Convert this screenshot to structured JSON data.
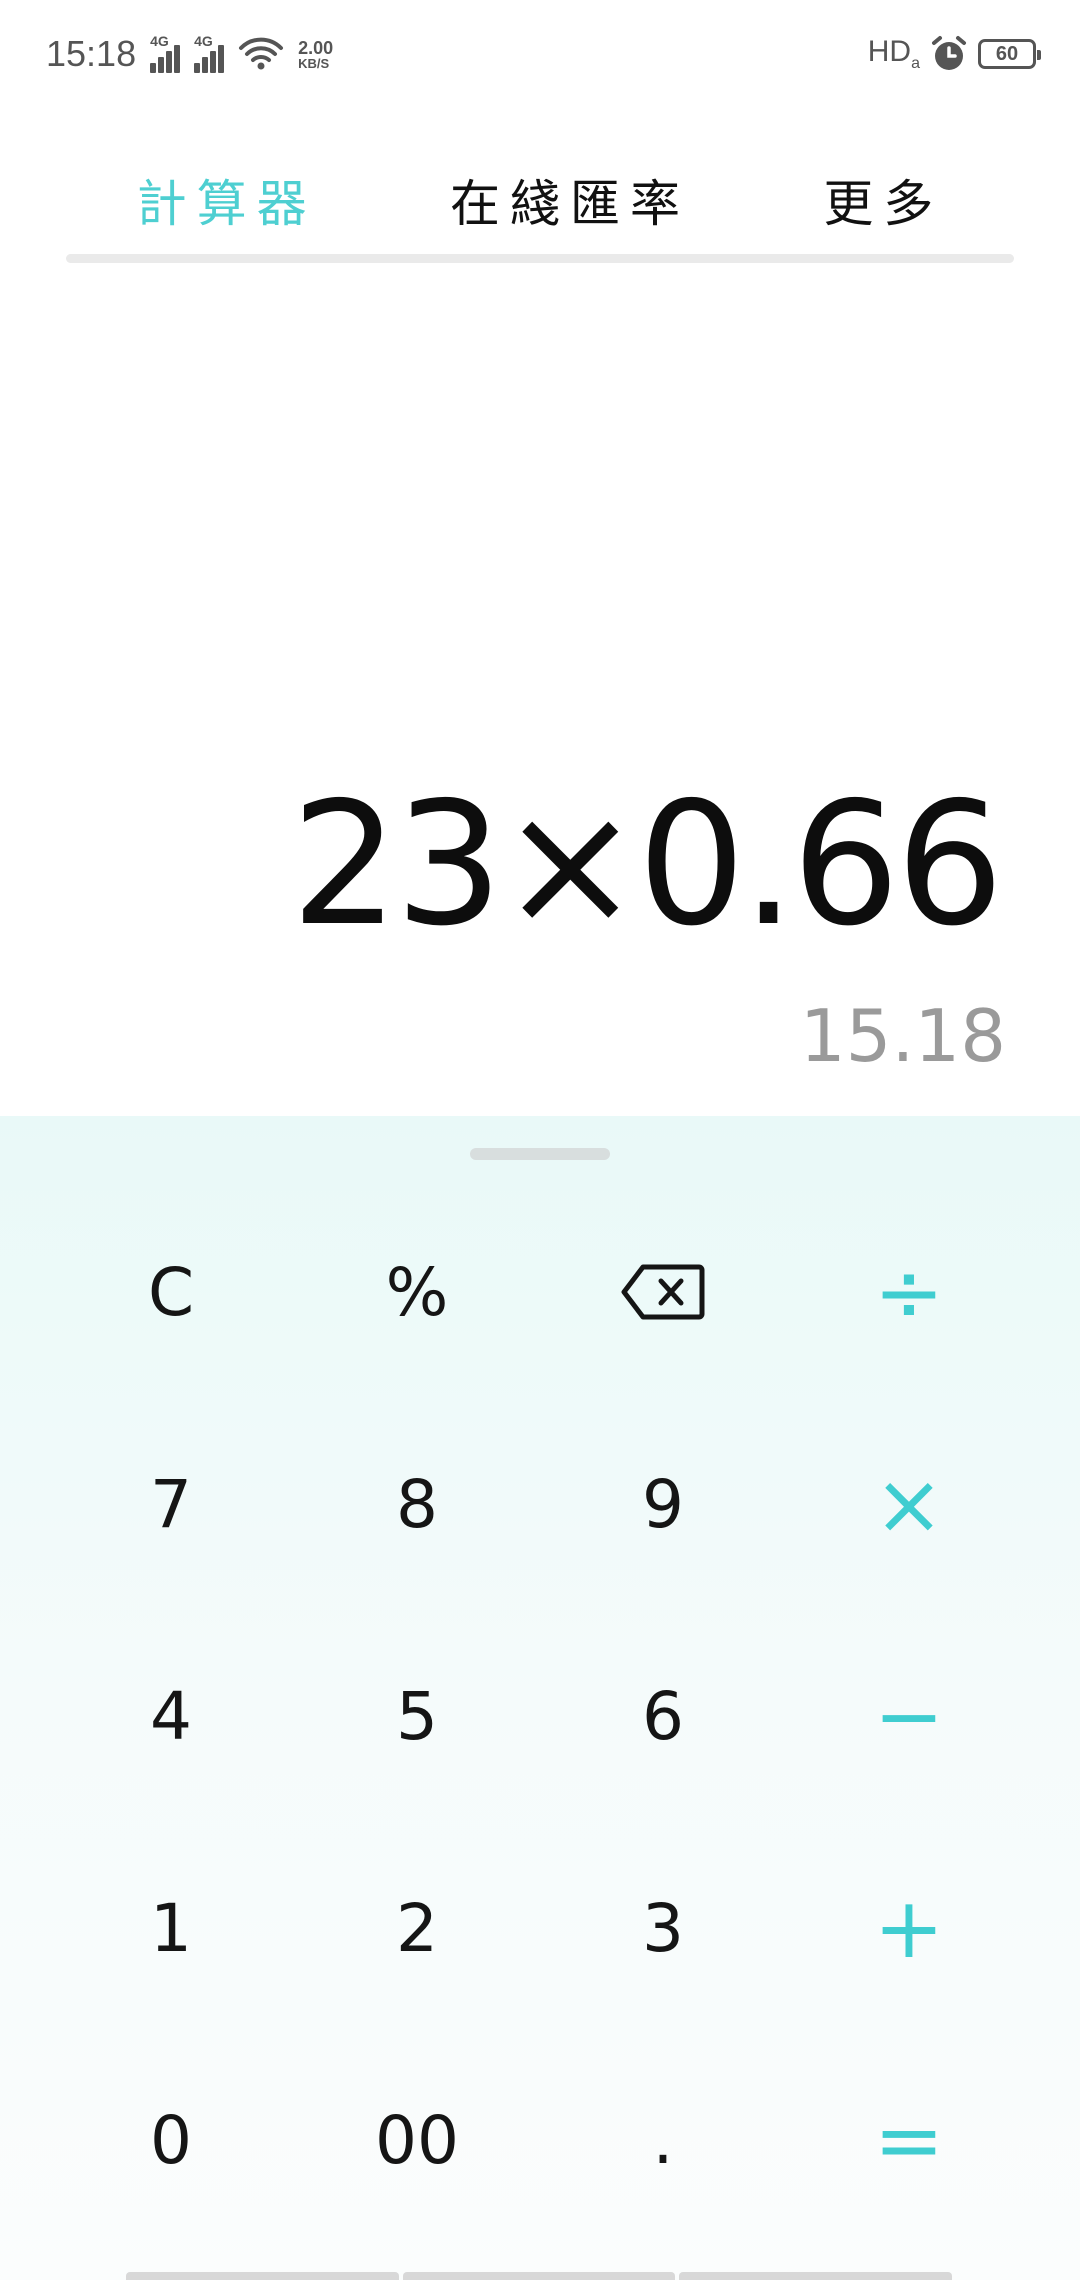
{
  "status_bar": {
    "time": "15:18",
    "network_1": "4G",
    "network_2": "4G",
    "speed_value": "2.00",
    "speed_unit": "KB/S",
    "hd_label": "HD",
    "hd_sub": "a",
    "battery": "60"
  },
  "tabs": [
    {
      "label": "計算器",
      "active": true
    },
    {
      "label": "在綫匯率",
      "active": false
    },
    {
      "label": "更多",
      "active": false
    }
  ],
  "display": {
    "expression": "23×0.66",
    "result": "15.18"
  },
  "keypad": {
    "clear": "C",
    "percent": "%",
    "backspace_icon": "backspace-icon",
    "divide": "÷",
    "seven": "7",
    "eight": "8",
    "nine": "9",
    "multiply": "×",
    "four": "4",
    "five": "5",
    "six": "6",
    "minus": "−",
    "one": "1",
    "two": "2",
    "three": "3",
    "plus": "+",
    "zero": "0",
    "double_zero": "00",
    "dot": ".",
    "equals": "="
  },
  "colors": {
    "accent": "#4ecfd1",
    "keypad_bg": "#e9f9f8",
    "text": "#151515",
    "result": "#9a9a9a"
  }
}
